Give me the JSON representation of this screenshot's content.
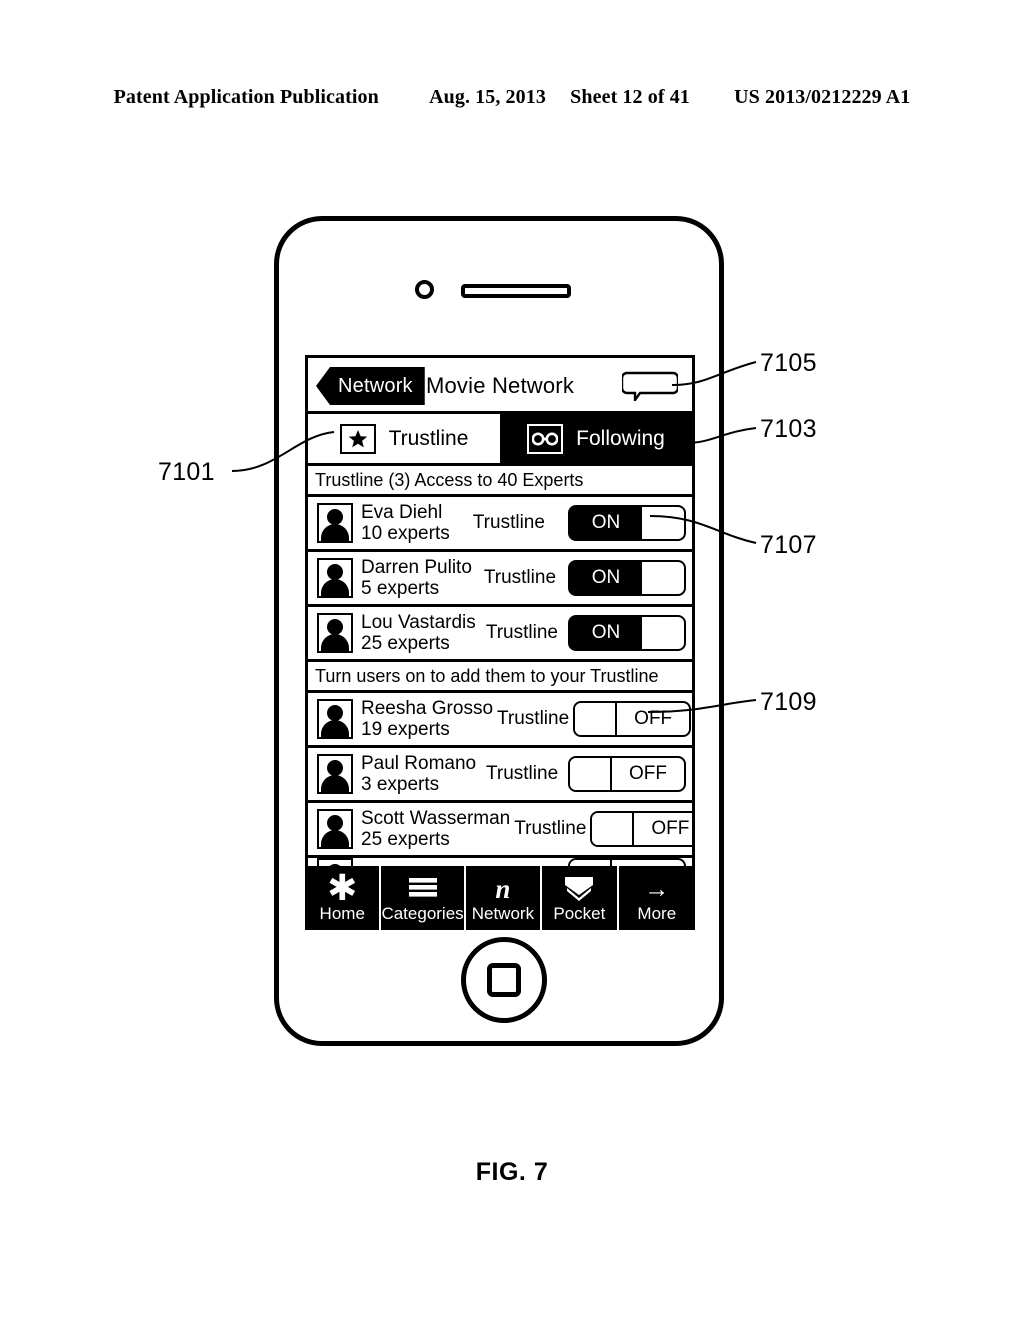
{
  "publication_header": {
    "left": "Patent Application Publication",
    "date": "Aug. 15, 2013",
    "sheet": "Sheet 12 of 41",
    "number": "US 2013/0212229 A1"
  },
  "figure_caption": "FIG. 7",
  "phone_screen": {
    "navbar": {
      "back_label": "Network",
      "title": "Movie Network",
      "chat_icon": "chat-bubble-icon"
    },
    "tabs": [
      {
        "label": "Trustline",
        "icon": "star-icon",
        "active": false
      },
      {
        "label": "Following",
        "icon": "glasses-icon",
        "active": true
      }
    ],
    "sections": [
      {
        "header": "Trustline (3) Access to 40 Experts",
        "rows": [
          {
            "name": "Eva Diehl",
            "experts": "10 experts",
            "toggle_label": "Trustline",
            "state": "ON"
          },
          {
            "name": "Darren Pulito",
            "experts": "5 experts",
            "toggle_label": "Trustline",
            "state": "ON"
          },
          {
            "name": "Lou Vastardis",
            "experts": "25 experts",
            "toggle_label": "Trustline",
            "state": "ON"
          }
        ]
      },
      {
        "header": "Turn users on to add them to your Trustline",
        "rows": [
          {
            "name": "Reesha Grosso",
            "experts": "19 experts",
            "toggle_label": "Trustline",
            "state": "OFF"
          },
          {
            "name": "Paul Romano",
            "experts": "3 experts",
            "toggle_label": "Trustline",
            "state": "OFF"
          },
          {
            "name": "Scott Wasserman",
            "experts": "25 experts",
            "toggle_label": "Trustline",
            "state": "OFF"
          }
        ]
      }
    ],
    "toolbar": [
      {
        "label": "Home",
        "icon": "asterisk-icon"
      },
      {
        "label": "Categories",
        "icon": "hamburger-icon"
      },
      {
        "label": "Network",
        "icon": "script-n-icon"
      },
      {
        "label": "Pocket",
        "icon": "chevron-down-pocket-icon"
      },
      {
        "label": "More",
        "icon": "arrow-right-icon"
      }
    ]
  },
  "reference_numerals": [
    {
      "id": "7101",
      "text": "7101"
    },
    {
      "id": "7103",
      "text": "7103"
    },
    {
      "id": "7105",
      "text": "7105"
    },
    {
      "id": "7107",
      "text": "7107"
    },
    {
      "id": "7109",
      "text": "7109"
    }
  ],
  "colors": {
    "ink": "#000000",
    "paper": "#ffffff"
  }
}
